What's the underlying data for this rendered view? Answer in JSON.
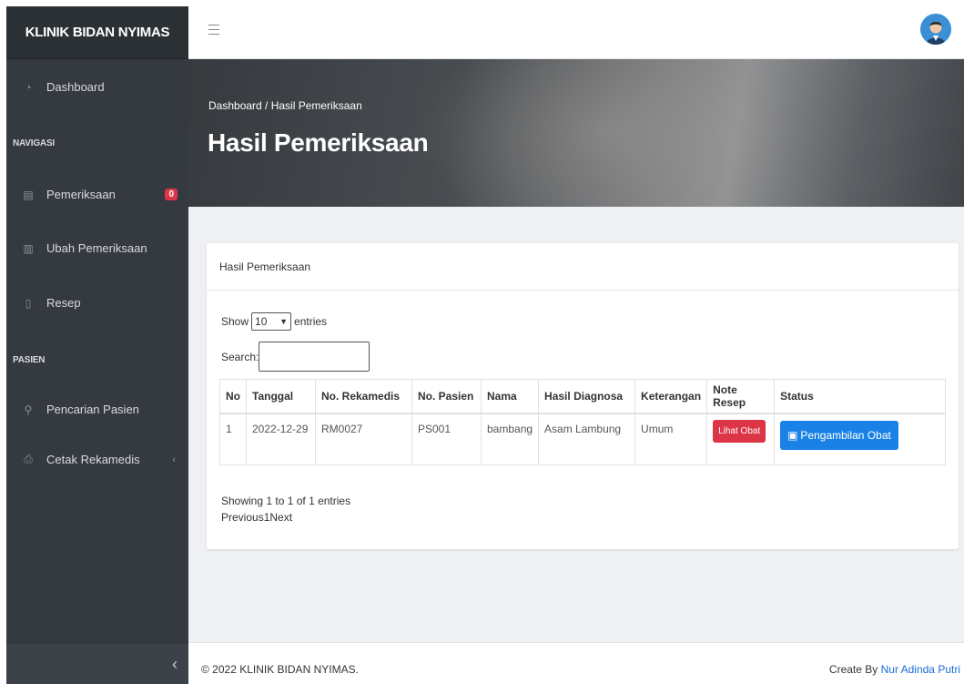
{
  "sidebar": {
    "brand": "KLINIK BIDAN NYIMAS",
    "dashboard": "Dashboard",
    "heading_navigasi": "NAVIGASI",
    "pemeriksaan": "Pemeriksaan",
    "pemeriksaan_badge": "0",
    "ubah_pemeriksaan": "Ubah Pemeriksaan",
    "resep": "Resep",
    "heading_pasien": "PASIEN",
    "pencarian_pasien": "Pencarian Pasien",
    "cetak_rekamedis": "Cetak Rekamedis",
    "collapse_icon": "‹",
    "expand_caret": "‹"
  },
  "hero": {
    "breadcrumb": "Dashboard / Hasil Pemeriksaan",
    "title": "Hasil Pemeriksaan"
  },
  "card": {
    "header": "Hasil Pemeriksaan",
    "show_label": "Show",
    "show_value": "10",
    "entries_label": "entries",
    "search_label": "Search:",
    "search_value": "",
    "columns": [
      "No",
      "Tanggal",
      "No. Rekamedis",
      "No. Pasien",
      "Nama",
      "Hasil Diagnosa",
      "Keterangan",
      "Note Resep",
      "Status"
    ],
    "rows": [
      {
        "no": "1",
        "tanggal": "2022-12-29",
        "rekamedis": "RM0027",
        "pasien": "PS001",
        "nama": "bambang",
        "diagnosa": "Asam Lambung",
        "keterangan": "Umum",
        "note_button": "Lihat Obat",
        "status_button": "Pengambilan Obat"
      }
    ],
    "info": "Showing 1 to 1 of 1 entries",
    "pagination": {
      "previous": "Previous",
      "page": "1",
      "next": "Next"
    }
  },
  "footer": {
    "copyright": "© 2022 KLINIK BIDAN NYIMAS.",
    "credit_prefix": "Create By ",
    "credit_name": "Nur Adinda Putri"
  }
}
